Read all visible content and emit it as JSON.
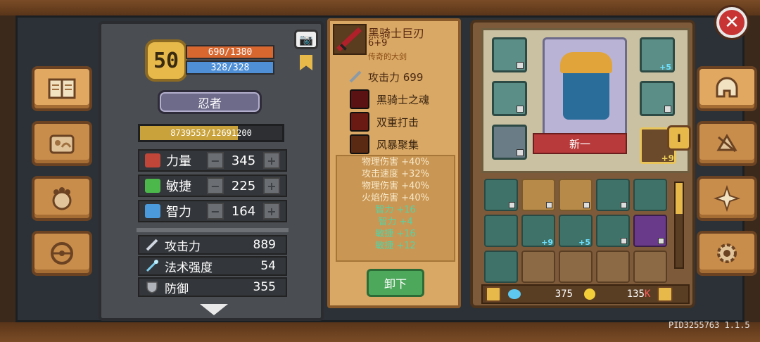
{
  "colors": {
    "hp": "#d8672f",
    "mp": "#4e8fd6",
    "accent_gold": "#e6b94a",
    "item_panel": "#d9a865",
    "bonus_green": "#4fd6a8"
  },
  "icons": {
    "left_nav": [
      "book-icon",
      "scroll-map-icon",
      "pet-paw-icon",
      "steering-wheel-icon"
    ],
    "right_nav": [
      "helmet-icon",
      "upgrade-arrows-icon",
      "compass-star-icon",
      "gear-icon"
    ],
    "close": "close-icon",
    "camera": "camera-icon"
  },
  "character": {
    "level": "50",
    "hp": "690/1380",
    "mp": "328/328",
    "class": "忍者",
    "xp": "8739553/12691200",
    "xp_fraction": 0.69,
    "stats": [
      {
        "name": "力量",
        "value": "345",
        "icon_color": "#c0463a"
      },
      {
        "name": "敏捷",
        "value": "225",
        "icon_color": "#4cb84c"
      },
      {
        "name": "智力",
        "value": "164",
        "icon_color": "#4a9adc"
      }
    ],
    "attributes": [
      {
        "name": "攻击力",
        "value": "889"
      },
      {
        "name": "法术强度",
        "value": "54"
      },
      {
        "name": "防御",
        "value": "355"
      }
    ]
  },
  "item": {
    "name": "黑骑士巨刃",
    "enhance": "6+9",
    "rarity": "传奇的大剑",
    "attack": "攻击力 699",
    "skills": [
      "黑骑士之魂",
      "双重打击",
      "风暴聚集"
    ],
    "bonuses": [
      {
        "text": "物理伤害 +40%",
        "green": false
      },
      {
        "text": "攻击速度 +32%",
        "green": false
      },
      {
        "text": "物理伤害 +40%",
        "green": false
      },
      {
        "text": "火焰伤害 +40%",
        "green": false
      },
      {
        "text": "智力 +16",
        "green": true
      },
      {
        "text": "智力 +4",
        "green": true
      },
      {
        "text": "敏捷 +16",
        "green": true
      },
      {
        "text": "敏捷 +12",
        "green": true
      }
    ],
    "unequip_label": "卸下"
  },
  "equipment": {
    "nickname": "新一",
    "slot_enhancements": {
      "left_top": "",
      "right_top": "+5",
      "weapon": "+9"
    },
    "tab_label": "I"
  },
  "inventory": {
    "cells": [
      {
        "kind": "filled",
        "enh": "",
        "lock": true
      },
      {
        "kind": "gold",
        "enh": "",
        "lock": true
      },
      {
        "kind": "gold",
        "enh": "",
        "lock": true
      },
      {
        "kind": "filled",
        "enh": "",
        "lock": true
      },
      {
        "kind": "filled",
        "enh": "",
        "lock": false
      },
      {
        "kind": "filled",
        "enh": "",
        "lock": false
      },
      {
        "kind": "filled",
        "enh": "+9",
        "lock": false
      },
      {
        "kind": "filled",
        "enh": "+5",
        "lock": false
      },
      {
        "kind": "filled",
        "enh": "",
        "lock": true
      },
      {
        "kind": "purple",
        "enh": "",
        "lock": true
      },
      {
        "kind": "filled",
        "enh": "",
        "lock": false
      },
      {
        "kind": "empty",
        "enh": "",
        "lock": false
      },
      {
        "kind": "empty",
        "enh": "",
        "lock": false
      },
      {
        "kind": "empty",
        "enh": "",
        "lock": false
      },
      {
        "kind": "empty",
        "enh": "",
        "lock": false
      }
    ],
    "gems": "375",
    "gold": "135",
    "gold_unit": "K"
  },
  "footer": {
    "pid": "PID3255763 1.1.5"
  }
}
